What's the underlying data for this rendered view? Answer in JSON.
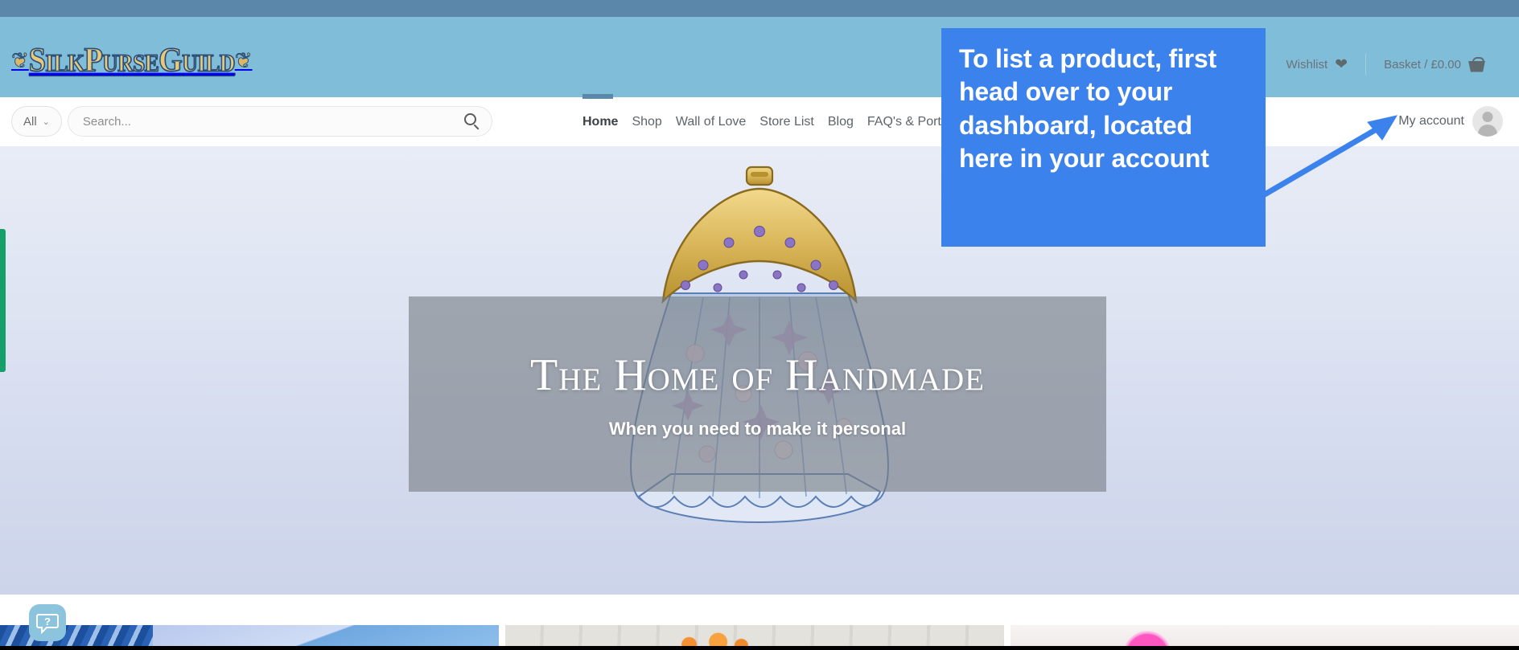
{
  "site": {
    "logo_text": "SilkPurseGuild",
    "flourish_left": "❦",
    "flourish_right": "❦"
  },
  "header": {
    "wishlist_label": "Wishlist",
    "wishlist_icon": "heart-icon",
    "basket_label": "Basket / £0.00",
    "basket_icon": "basket-icon"
  },
  "search": {
    "category_label": "All",
    "category_caret": "⌄",
    "placeholder": "Search...",
    "value": "",
    "search_icon": "search-icon"
  },
  "nav": {
    "items": [
      {
        "label": "Home",
        "active": true,
        "has_caret": false
      },
      {
        "label": "Shop",
        "active": false,
        "has_caret": false
      },
      {
        "label": "Wall of Love",
        "active": false,
        "has_caret": false
      },
      {
        "label": "Store List",
        "active": false,
        "has_caret": false
      },
      {
        "label": "Blog",
        "active": false,
        "has_caret": false
      },
      {
        "label": "FAQ's & Portal",
        "active": false,
        "has_caret": true
      }
    ],
    "caret": "⌄"
  },
  "account": {
    "label": "My account",
    "avatar_icon": "user-avatar-icon"
  },
  "hero": {
    "title": "The Home of Handmade",
    "subtitle": "When you need to make it personal",
    "image_alt": "handmade gold-framed jewelled floral purse"
  },
  "annotation": {
    "text": "To list a product, first head over to your dashboard, located here in your account",
    "box_color": "#3b82ec",
    "arrow_color": "#3b82ec",
    "arrow_points_to": "My account"
  },
  "widgets": {
    "help_icon": "question-chat-icon",
    "side_tab_color": "#15a06a"
  },
  "colors": {
    "topbar": "#5b87ab",
    "header": "#80bdd9",
    "accent": "#3b82ec",
    "logo_gold": "#e8c979",
    "logo_outline": "#2b4f7a"
  },
  "tiles": [
    {
      "name": "blue-patterned-fabric-tile"
    },
    {
      "name": "orange-flowers-tile"
    },
    {
      "name": "pink-pompom-tile"
    }
  ]
}
